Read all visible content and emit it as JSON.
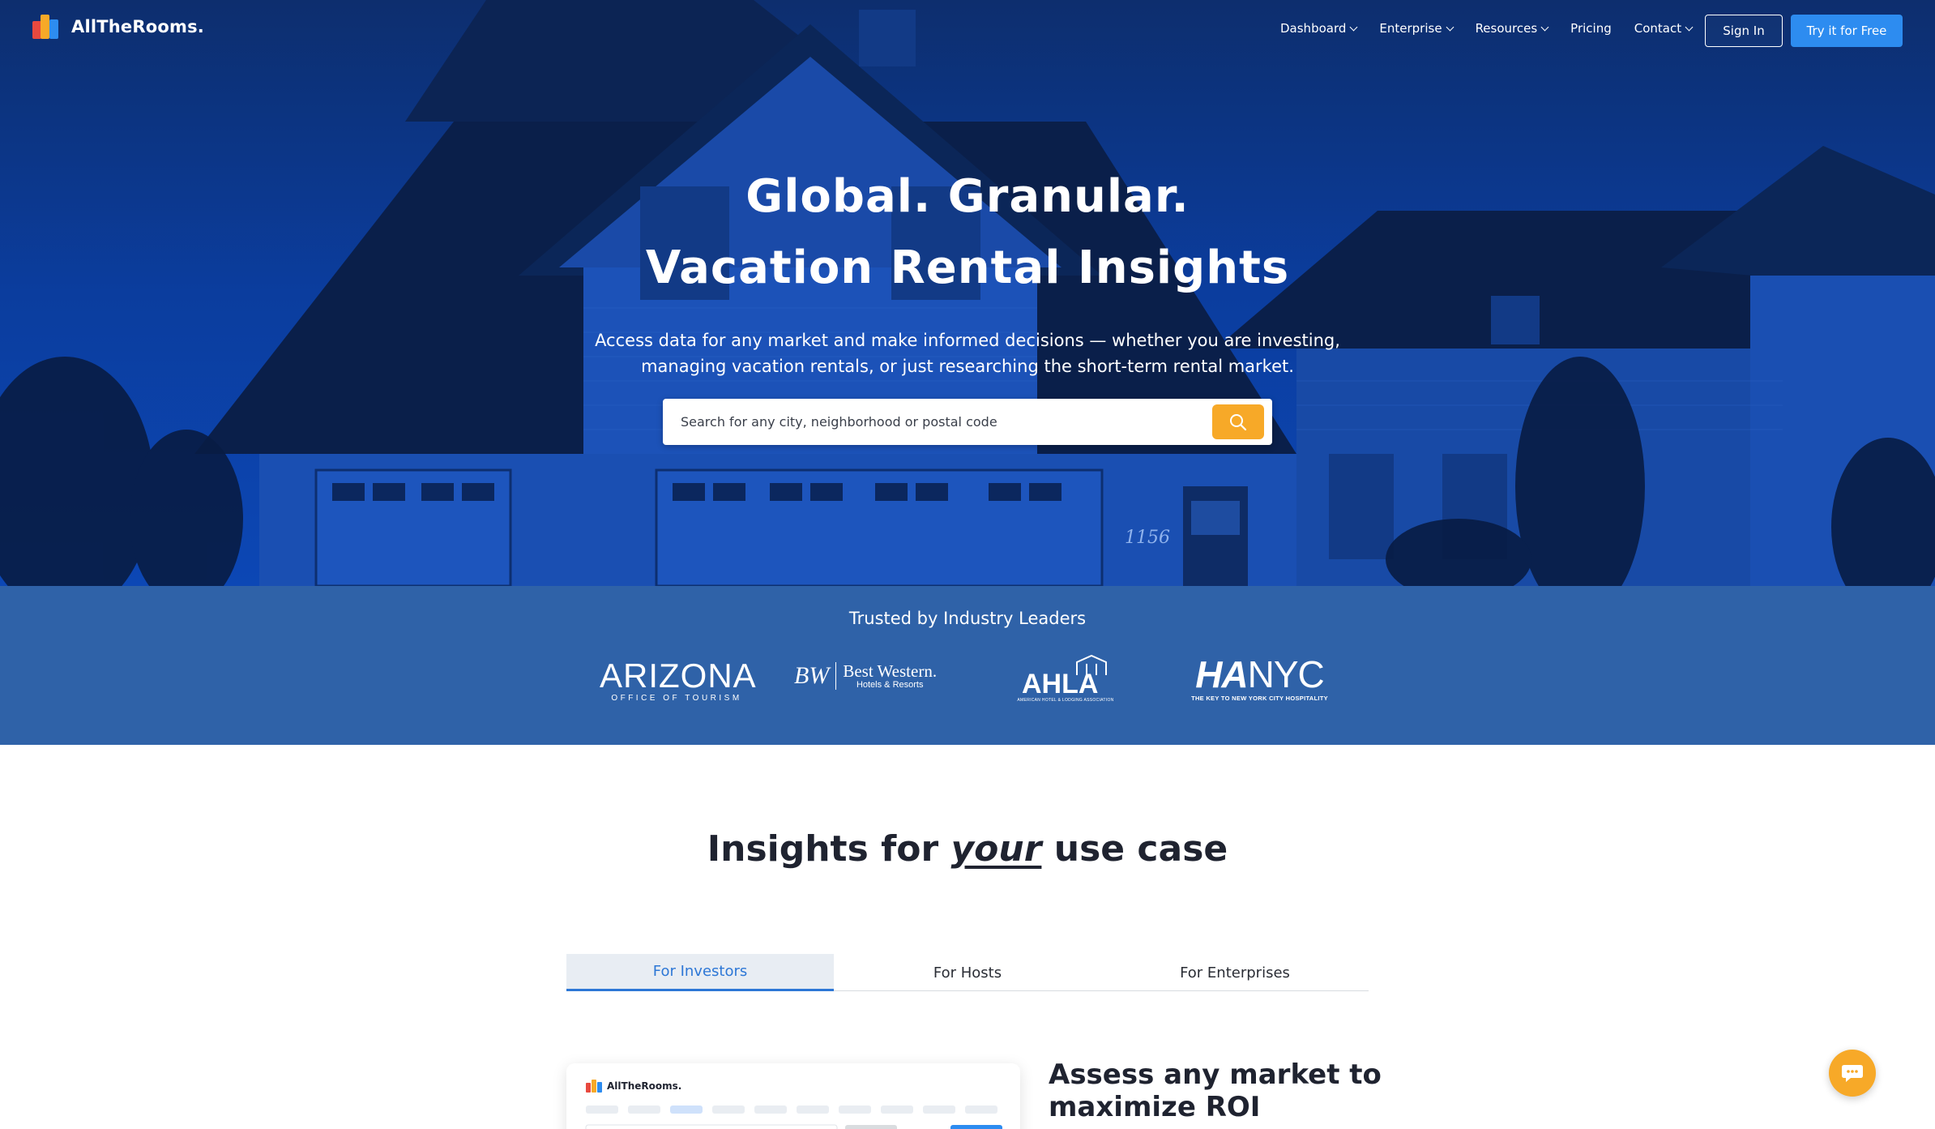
{
  "brand": {
    "name": "AllTheRooms.",
    "logo_colors": [
      "#e8493f",
      "#f7a928",
      "#2d8cf0"
    ]
  },
  "nav": {
    "items": [
      {
        "label": "Dashboard",
        "has_dropdown": true
      },
      {
        "label": "Enterprise",
        "has_dropdown": true
      },
      {
        "label": "Resources",
        "has_dropdown": true
      },
      {
        "label": "Pricing",
        "has_dropdown": false
      },
      {
        "label": "Contact",
        "has_dropdown": true
      }
    ],
    "signin_label": "Sign In",
    "try_label": "Try it for Free"
  },
  "hero": {
    "title_line1": "Global. Granular.",
    "title_line2": "Vacation Rental Insights",
    "subtitle_line1": "Access data for any market and make informed decisions — whether you are investing,",
    "subtitle_line2": "managing vacation rentals, or just researching the short-term rental market.",
    "search_placeholder": "Search for any city, neighborhood or postal code",
    "house_number": "1156"
  },
  "trust": {
    "title": "Trusted by Industry Leaders",
    "logos": [
      {
        "name": "arizona-logo",
        "main": "ARIZONA",
        "sub": "OFFICE OF TOURISM"
      },
      {
        "name": "best-western-logo",
        "mark": "BW",
        "main": "Best Western.",
        "sub": "Hotels & Resorts"
      },
      {
        "name": "ahla-logo",
        "main": "AHLA",
        "sub": "AMERICAN HOTEL & LODGING ASSOCIATION"
      },
      {
        "name": "hanyc-logo",
        "main_a": "HA",
        "main_b": "NYC",
        "sub": "THE KEY TO NEW YORK CITY HOSPITALITY"
      }
    ]
  },
  "insights": {
    "title_before": "Insights for ",
    "title_em": "your",
    "title_after": " use case",
    "tabs": [
      {
        "label": "For Investors",
        "active": true
      },
      {
        "label": "For Hosts",
        "active": false
      },
      {
        "label": "For Enterprises",
        "active": false
      }
    ],
    "preview_brand": "AllTheRooms.",
    "heading_line1": "Assess any market to",
    "heading_line2": "maximize ROI"
  },
  "colors": {
    "hero_blue": "#0b3a9a",
    "trust_blue": "#2f62a8",
    "accent_orange": "#f7a928",
    "primary_blue": "#2d8cf0",
    "tab_active": "#2d77d6"
  }
}
